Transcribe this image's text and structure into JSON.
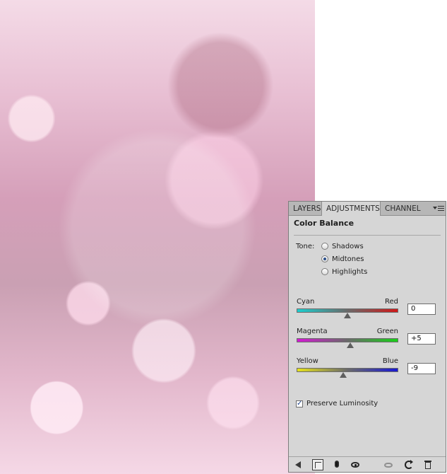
{
  "panel": {
    "tabs": [
      {
        "label": "LAYERS"
      },
      {
        "label": "ADJUSTMENTS"
      },
      {
        "label": "CHANNEL"
      }
    ],
    "title": "Color Balance",
    "tone": {
      "label": "Tone:",
      "options": [
        {
          "label": "Shadows",
          "checked": false
        },
        {
          "label": "Midtones",
          "checked": true
        },
        {
          "label": "Highlights",
          "checked": false
        }
      ]
    },
    "sliders": [
      {
        "left": "Cyan",
        "right": "Red",
        "value": "0"
      },
      {
        "left": "Magenta",
        "right": "Green",
        "value": "+5"
      },
      {
        "left": "Yellow",
        "right": "Blue",
        "value": "-9"
      }
    ],
    "preserve_luminosity": {
      "label": "Preserve Luminosity",
      "checked": true
    },
    "icons": {
      "menu": "panel-menu-icon",
      "back": "back-arrow-icon",
      "expand": "expand-view-icon",
      "clip": "clip-to-layer-icon",
      "visibility": "visibility-eye-icon",
      "previous": "view-previous-state-icon",
      "reset": "reset-icon",
      "delete": "trash-icon"
    }
  }
}
